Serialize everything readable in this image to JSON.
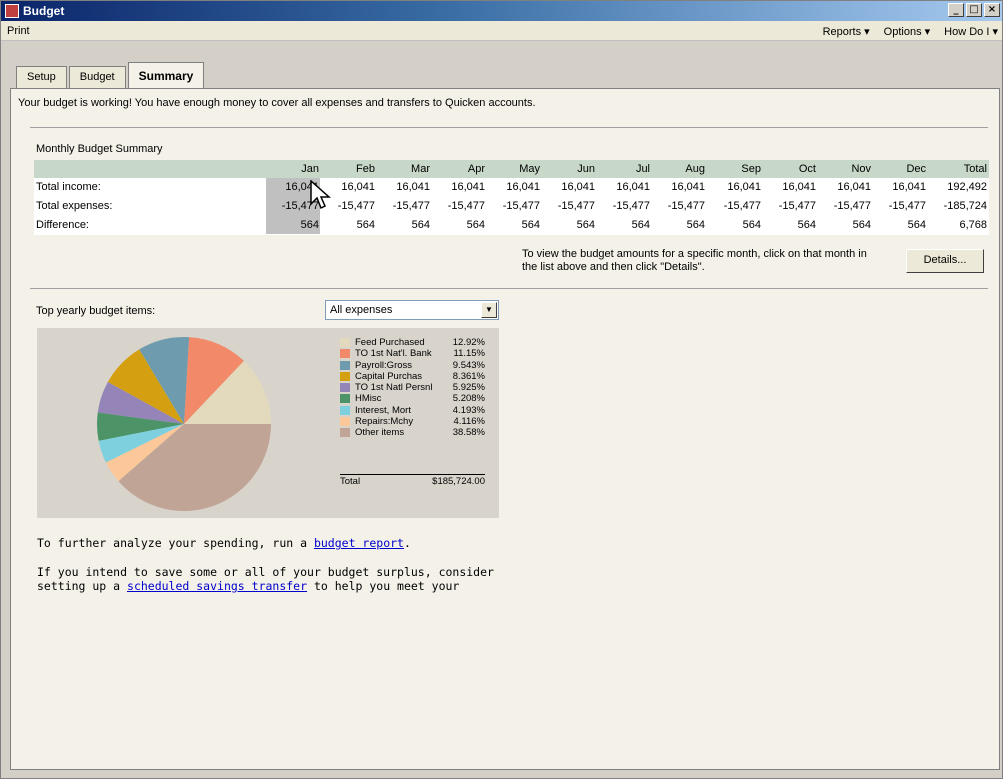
{
  "window": {
    "title": "Budget"
  },
  "menubar": {
    "print": "Print",
    "reports": "Reports ▾",
    "options": "Options ▾",
    "how_do_i": "How Do I ▾"
  },
  "tabs": [
    {
      "label": "Setup"
    },
    {
      "label": "Budget"
    },
    {
      "label": "Summary"
    }
  ],
  "status_message": "Your budget is working! You have enough money to cover all expenses and transfers to Quicken accounts.",
  "summary": {
    "title": "Monthly Budget Summary",
    "columns": [
      "Jan",
      "Feb",
      "Mar",
      "Apr",
      "May",
      "Jun",
      "Jul",
      "Aug",
      "Sep",
      "Oct",
      "Nov",
      "Dec",
      "Total"
    ],
    "rows": [
      {
        "label": "Total income:",
        "values": [
          "16,041",
          "16,041",
          "16,041",
          "16,041",
          "16,041",
          "16,041",
          "16,041",
          "16,041",
          "16,041",
          "16,041",
          "16,041",
          "16,041",
          "192,492"
        ]
      },
      {
        "label": "Total expenses:",
        "values": [
          "-15,477",
          "-15,477",
          "-15,477",
          "-15,477",
          "-15,477",
          "-15,477",
          "-15,477",
          "-15,477",
          "-15,477",
          "-15,477",
          "-15,477",
          "-15,477",
          "-185,724"
        ]
      },
      {
        "label": "Difference:",
        "values": [
          "564",
          "564",
          "564",
          "564",
          "564",
          "564",
          "564",
          "564",
          "564",
          "564",
          "564",
          "564",
          "6,768"
        ]
      }
    ],
    "hint": "To view the budget amounts for a specific month, click on that month in the list above and then click \"Details\".",
    "details_button": "Details..."
  },
  "top_items": {
    "label": "Top yearly budget items:",
    "filter_value": "All expenses"
  },
  "chart_data": {
    "type": "pie",
    "slices": [
      {
        "name": "Feed Purchased",
        "percent": 12.92,
        "label": "12.92%",
        "color": "#e3d9bd"
      },
      {
        "name": "TO 1st Nat'l. Bank",
        "percent": 11.15,
        "label": "11.15%",
        "color": "#f28a6a"
      },
      {
        "name": "Payroll:Gross",
        "percent": 9.543,
        "label": "9.543%",
        "color": "#6e9cae"
      },
      {
        "name": "Capital Purchas",
        "percent": 8.361,
        "label": "8.361%",
        "color": "#d4a011"
      },
      {
        "name": "TO 1st Natl Persnl",
        "percent": 5.925,
        "label": "5.925%",
        "color": "#9584b8"
      },
      {
        "name": "HMisc",
        "percent": 5.208,
        "label": "5.208%",
        "color": "#4c9467"
      },
      {
        "name": "Interest, Mort",
        "percent": 4.193,
        "label": "4.193%",
        "color": "#7fd0de"
      },
      {
        "name": "Repairs:Mchy",
        "percent": 4.116,
        "label": "4.116%",
        "color": "#fcc89a"
      },
      {
        "name": "Other items",
        "percent": 38.58,
        "label": "38.58%",
        "color": "#c0a596"
      }
    ],
    "total_label": "Total",
    "total_value": "$185,724.00"
  },
  "paragraphs": {
    "p1_pre": "To further analyze your spending, run a ",
    "p1_link": "budget report",
    "p1_post": ".",
    "p2_pre": "If you intend to save some or all of your budget surplus, consider",
    "p2_pre2": "setting up a ",
    "p2_link": "scheduled savings transfer",
    "p2_post": " to help you meet your"
  }
}
